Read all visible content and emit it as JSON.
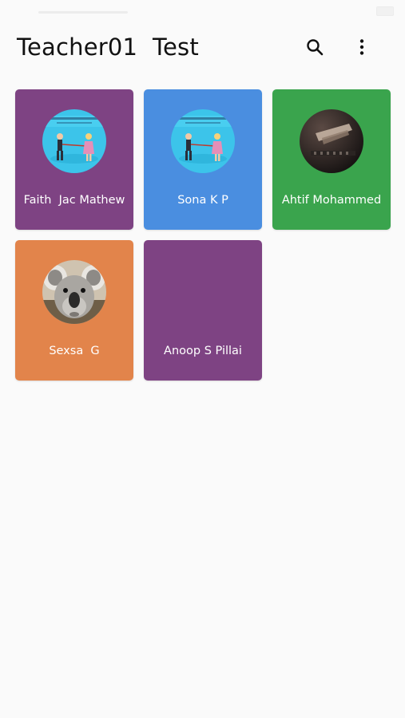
{
  "header": {
    "title": "Teacher01  Test",
    "search_icon": "search-icon",
    "more_icon": "more-vertical-icon"
  },
  "students": [
    {
      "name": "Faith  Jac Mathew",
      "color": "#7e4383",
      "avatar": "cartoon-couple-image"
    },
    {
      "name": "Sona K P",
      "color": "#4a8ee0",
      "avatar": "cartoon-couple-image"
    },
    {
      "name": "Ahtif Mohammed",
      "color": "#3aa44d",
      "avatar": "piano-hands-image"
    },
    {
      "name": "Sexsa  G",
      "color": "#e2844b",
      "avatar": "koala-image"
    },
    {
      "name": "Anoop S Pillai",
      "color": "#7e4383",
      "avatar": ""
    }
  ]
}
